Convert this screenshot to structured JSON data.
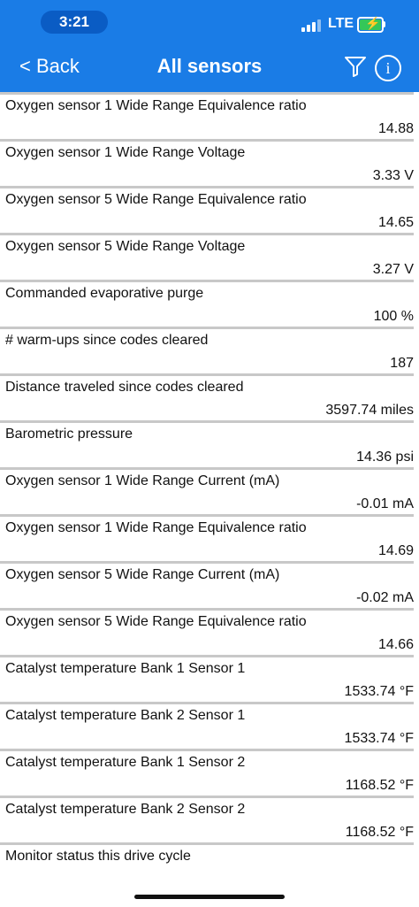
{
  "status_bar": {
    "time": "3:21",
    "network": "LTE",
    "battery_color": "#34c759"
  },
  "nav": {
    "back_label": "< Back",
    "title": "All sensors",
    "background": "#1a7ce6",
    "filter_icon": "filter-icon",
    "info_icon": "info-icon",
    "info_glyph": "i"
  },
  "sensors": [
    {
      "label": "Oxygen sensor 1 Wide Range Equivalence ratio",
      "value": "14.88"
    },
    {
      "label": "Oxygen sensor 1 Wide Range Voltage",
      "value": "3.33 V"
    },
    {
      "label": "Oxygen sensor 5 Wide Range Equivalence ratio",
      "value": "14.65"
    },
    {
      "label": "Oxygen sensor 5 Wide Range Voltage",
      "value": "3.27 V"
    },
    {
      "label": "Commanded evaporative purge",
      "value": "100 %"
    },
    {
      "label": "# warm-ups since codes cleared",
      "value": "187"
    },
    {
      "label": "Distance traveled since codes cleared",
      "value": "3597.74 miles"
    },
    {
      "label": "Barometric pressure",
      "value": "14.36 psi"
    },
    {
      "label": "Oxygen sensor 1 Wide Range Current (mA)",
      "value": "-0.01 mA"
    },
    {
      "label": "Oxygen sensor 1 Wide Range Equivalence ratio",
      "value": "14.69"
    },
    {
      "label": "Oxygen sensor 5 Wide Range Current (mA)",
      "value": "-0.02 mA"
    },
    {
      "label": "Oxygen sensor 5 Wide Range Equivalence ratio",
      "value": "14.66"
    },
    {
      "label": "Catalyst temperature Bank 1 Sensor 1",
      "value": "1533.74 °F"
    },
    {
      "label": "Catalyst temperature Bank 2 Sensor 1",
      "value": "1533.74 °F"
    },
    {
      "label": "Catalyst temperature Bank 1 Sensor 2",
      "value": "1168.52 °F"
    },
    {
      "label": "Catalyst temperature Bank 2 Sensor 2",
      "value": "1168.52 °F"
    },
    {
      "label": "Monitor status this drive cycle",
      "value": ""
    }
  ]
}
